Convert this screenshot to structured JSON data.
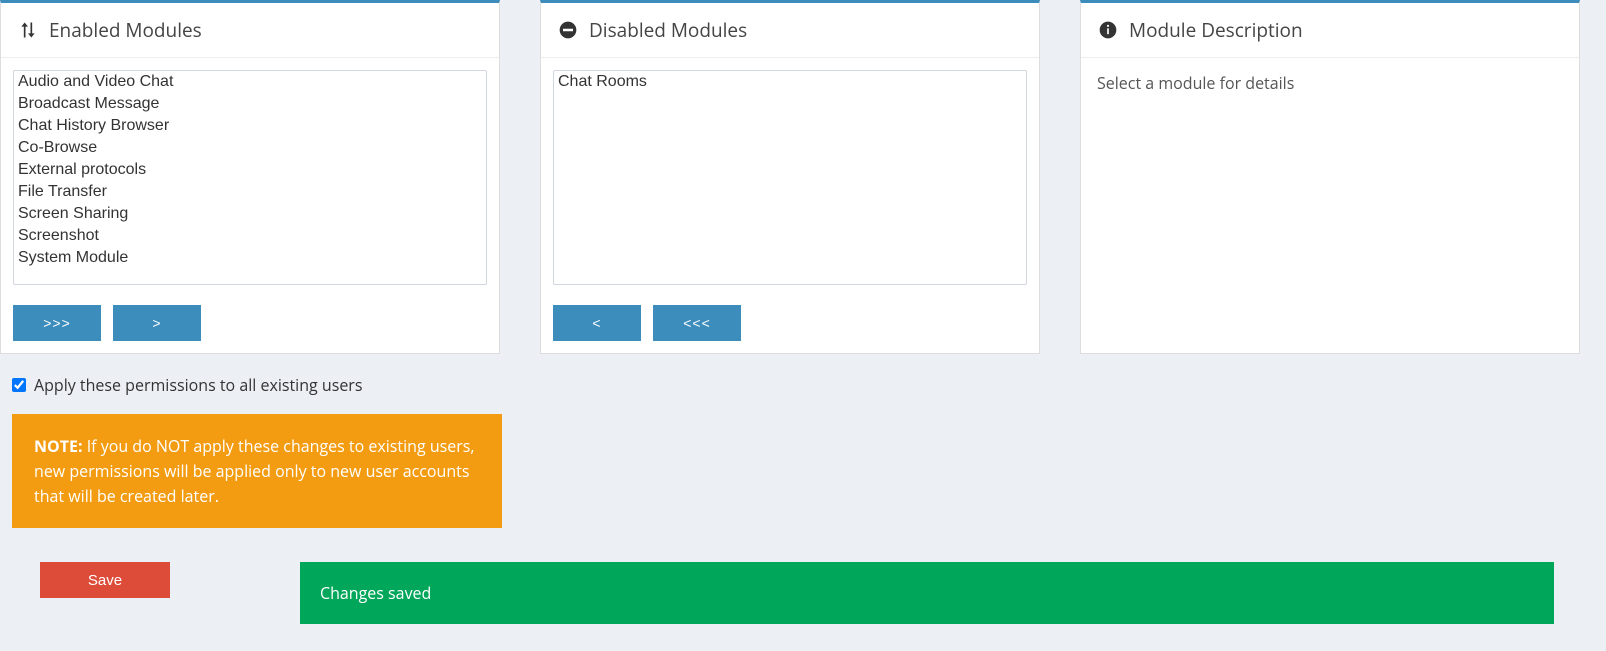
{
  "enabled": {
    "title": "Enabled Modules",
    "items": [
      "Audio and Video Chat",
      "Broadcast Message",
      "Chat History Browser",
      "Co-Browse",
      "External protocols",
      "File Transfer",
      "Screen Sharing",
      "Screenshot",
      "System Module"
    ],
    "btn_all": ">>>",
    "btn_one": ">"
  },
  "disabled": {
    "title": "Disabled Modules",
    "items": [
      "Chat Rooms"
    ],
    "btn_one": "<",
    "btn_all": "<<<"
  },
  "description": {
    "title": "Module Description",
    "placeholder": "Select a module for details"
  },
  "apply": {
    "label": "Apply these permissions to all existing users",
    "checked": true
  },
  "note": {
    "prefix": "NOTE:",
    "text": " If you do NOT apply these changes to existing users, new permissions will be applied only to new user accounts that will be created later."
  },
  "save_label": "Save",
  "success_message": "Changes saved"
}
